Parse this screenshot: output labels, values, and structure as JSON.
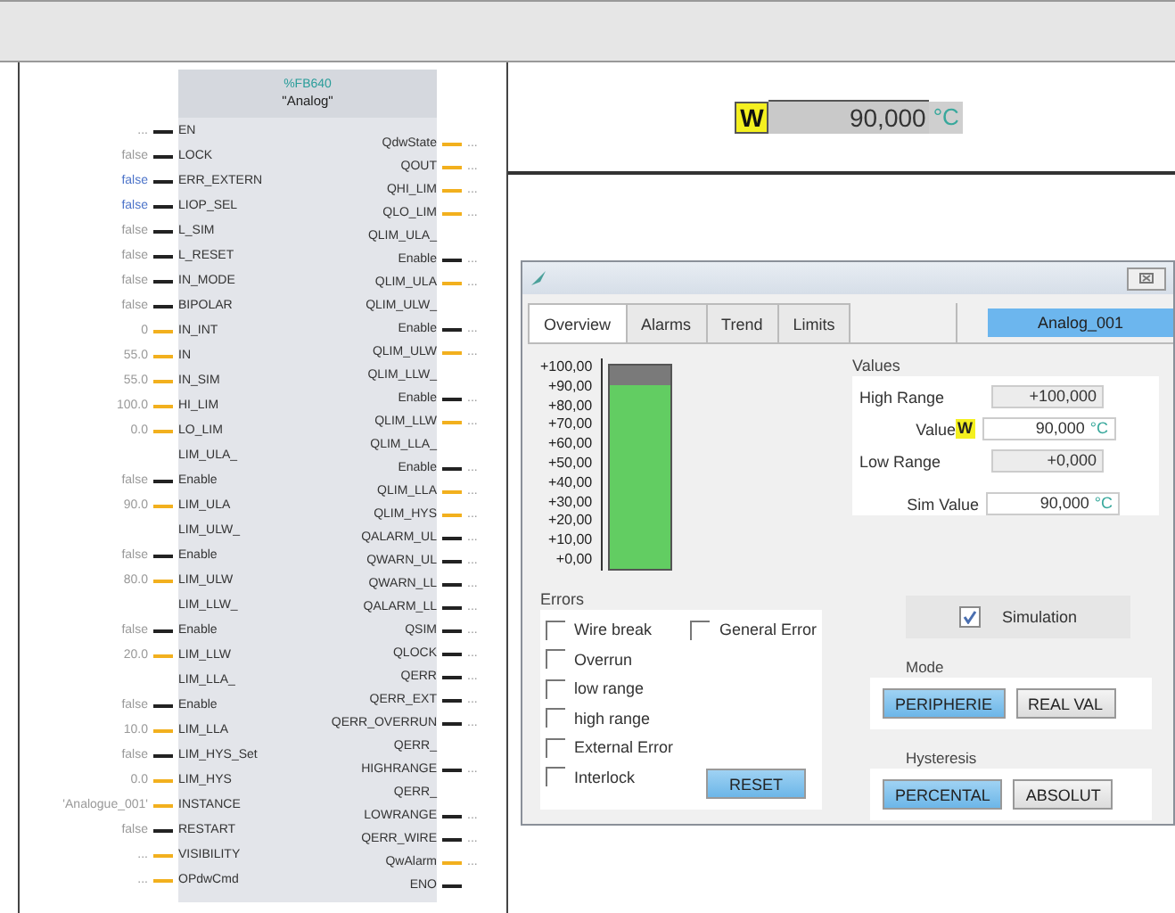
{
  "block": {
    "number": "%FB640",
    "name": "\"Analog\"",
    "inputs": [
      {
        "value": "...",
        "name": "EN",
        "kind": "bool",
        "highlighted": false
      },
      {
        "value": "false",
        "name": "LOCK",
        "kind": "bool",
        "highlighted": false
      },
      {
        "value": "false",
        "name": "ERR_EXTERN",
        "kind": "bool",
        "highlighted": true
      },
      {
        "value": "false",
        "name": "LIOP_SEL",
        "kind": "bool",
        "highlighted": true
      },
      {
        "value": "false",
        "name": "L_SIM",
        "kind": "bool",
        "highlighted": false
      },
      {
        "value": "false",
        "name": "L_RESET",
        "kind": "bool",
        "highlighted": false
      },
      {
        "value": "false",
        "name": "IN_MODE",
        "kind": "bool",
        "highlighted": false
      },
      {
        "value": "false",
        "name": "BIPOLAR",
        "kind": "bool",
        "highlighted": false
      },
      {
        "value": "0",
        "name": "IN_INT",
        "kind": "analog",
        "highlighted": false
      },
      {
        "value": "55.0",
        "name": "IN",
        "kind": "analog",
        "highlighted": false
      },
      {
        "value": "55.0",
        "name": "IN_SIM",
        "kind": "analog",
        "highlighted": false
      },
      {
        "value": "100.0",
        "name": "HI_LIM",
        "kind": "analog",
        "highlighted": false
      },
      {
        "value": "0.0",
        "name": "LO_LIM",
        "kind": "analog",
        "highlighted": false
      },
      {
        "value": "false",
        "name": "LIM_ULA_\nEnable",
        "kind": "bool",
        "highlighted": false
      },
      {
        "value": "90.0",
        "name": "LIM_ULA",
        "kind": "analog",
        "highlighted": false
      },
      {
        "value": "false",
        "name": "LIM_ULW_\nEnable",
        "kind": "bool",
        "highlighted": false
      },
      {
        "value": "80.0",
        "name": "LIM_ULW",
        "kind": "analog",
        "highlighted": false
      },
      {
        "value": "false",
        "name": "LIM_LLW_\nEnable",
        "kind": "bool",
        "highlighted": false
      },
      {
        "value": "20.0",
        "name": "LIM_LLW",
        "kind": "analog",
        "highlighted": false
      },
      {
        "value": "false",
        "name": "LIM_LLA_\nEnable",
        "kind": "bool",
        "highlighted": false
      },
      {
        "value": "10.0",
        "name": "LIM_LLA",
        "kind": "analog",
        "highlighted": false
      },
      {
        "value": "false",
        "name": "LIM_HYS_Set",
        "kind": "bool",
        "highlighted": false
      },
      {
        "value": "0.0",
        "name": "LIM_HYS",
        "kind": "analog",
        "highlighted": false
      },
      {
        "value": "'Analogue_001'",
        "name": "INSTANCE",
        "kind": "analog",
        "highlighted": false
      },
      {
        "value": "false",
        "name": "RESTART",
        "kind": "bool",
        "highlighted": false
      },
      {
        "value": "...",
        "name": "VISIBILITY",
        "kind": "analog",
        "highlighted": false
      },
      {
        "value": "...",
        "name": "OPdwCmd",
        "kind": "analog",
        "highlighted": false
      }
    ],
    "outputs": [
      {
        "name": "QdwState",
        "kind": "analog",
        "value": "..."
      },
      {
        "name": "QOUT",
        "kind": "analog",
        "value": "..."
      },
      {
        "name": "QHI_LIM",
        "kind": "analog",
        "value": "..."
      },
      {
        "name": "QLO_LIM",
        "kind": "analog",
        "value": "..."
      },
      {
        "name": "QLIM_ULA_\nEnable",
        "kind": "bool",
        "value": "..."
      },
      {
        "name": "QLIM_ULA",
        "kind": "analog",
        "value": "..."
      },
      {
        "name": "QLIM_ULW_\nEnable",
        "kind": "bool",
        "value": "..."
      },
      {
        "name": "QLIM_ULW",
        "kind": "analog",
        "value": "..."
      },
      {
        "name": "QLIM_LLW_\nEnable",
        "kind": "bool",
        "value": "..."
      },
      {
        "name": "QLIM_LLW",
        "kind": "analog",
        "value": "..."
      },
      {
        "name": "QLIM_LLA_\nEnable",
        "kind": "bool",
        "value": "..."
      },
      {
        "name": "QLIM_LLA",
        "kind": "analog",
        "value": "..."
      },
      {
        "name": "QLIM_HYS",
        "kind": "analog",
        "value": "..."
      },
      {
        "name": "QALARM_UL",
        "kind": "bool",
        "value": "..."
      },
      {
        "name": "QWARN_UL",
        "kind": "bool",
        "value": "..."
      },
      {
        "name": "QWARN_LL",
        "kind": "bool",
        "value": "..."
      },
      {
        "name": "QALARM_LL",
        "kind": "bool",
        "value": "..."
      },
      {
        "name": "QSIM",
        "kind": "bool",
        "value": "..."
      },
      {
        "name": "QLOCK",
        "kind": "bool",
        "value": "..."
      },
      {
        "name": "QERR",
        "kind": "bool",
        "value": "..."
      },
      {
        "name": "QERR_EXT",
        "kind": "bool",
        "value": "..."
      },
      {
        "name": "QERR_OVERRUN",
        "kind": "bool",
        "value": "..."
      },
      {
        "name": "QERR_\nHIGHRANGE",
        "kind": "bool",
        "value": "..."
      },
      {
        "name": "QERR_\nLOWRANGE",
        "kind": "bool",
        "value": "..."
      },
      {
        "name": "QERR_WIRE",
        "kind": "bool",
        "value": "..."
      },
      {
        "name": "QwAlarm",
        "kind": "analog",
        "value": "..."
      },
      {
        "name": "ENO",
        "kind": "bool"
      }
    ]
  },
  "display": {
    "symbol": "W",
    "value": "90,000",
    "unit": "°C"
  },
  "faceplate": {
    "tabs": [
      {
        "label": "Overview",
        "selected": true
      },
      {
        "label": "Alarms",
        "selected": false
      },
      {
        "label": "Trend",
        "selected": false
      },
      {
        "label": "Limits",
        "selected": false
      }
    ],
    "instance": "Analog_001",
    "bar": {
      "scale": [
        "+100,00",
        "+90,00",
        "+80,00",
        "+70,00",
        "+60,00",
        "+50,00",
        "+40,00",
        "+30,00",
        "+20,00",
        "+10,00",
        "+0,00"
      ],
      "level": 0.9
    },
    "values": {
      "title": "Values",
      "rows": [
        {
          "kind": "range",
          "label": "High Range",
          "value": "+100,000"
        },
        {
          "kind": "value",
          "label": "Value",
          "symbol": "W",
          "value": "90,000",
          "unit": "°C"
        },
        {
          "kind": "range",
          "label": "Low Range",
          "value": "+0,000"
        },
        {
          "kind": "sim",
          "label": "Sim Value",
          "value": "90,000",
          "unit": "°C"
        }
      ]
    },
    "errors": {
      "title": "Errors",
      "items": [
        {
          "label": "Wire break",
          "checked": false
        },
        {
          "label": "Overrun",
          "checked": false
        },
        {
          "label": "low range",
          "checked": false
        },
        {
          "label": "high range",
          "checked": false
        },
        {
          "label": "External Error",
          "checked": false
        },
        {
          "label": "Interlock",
          "checked": false
        }
      ],
      "general": {
        "label": "General Error",
        "checked": false
      },
      "reset": "RESET"
    },
    "simulation": {
      "label": "Simulation",
      "checked": true
    },
    "mode": {
      "title": "Mode",
      "options": [
        {
          "label": "PERIPHERIE",
          "selected": true
        },
        {
          "label": "REAL VAL",
          "selected": false
        }
      ]
    },
    "hysteresis": {
      "title": "Hysteresis",
      "options": [
        {
          "label": "PERCENTAL",
          "selected": true
        },
        {
          "label": "ABSOLUT",
          "selected": false
        }
      ]
    }
  }
}
